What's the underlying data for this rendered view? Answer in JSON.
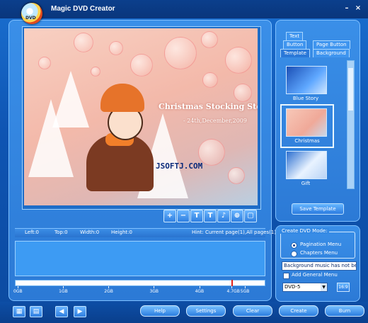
{
  "app": {
    "title": "Magic DVD Creator",
    "logo_text": "DVD",
    "minimize": "–",
    "close": "×"
  },
  "preview": {
    "title": "Christmas Stocking Story",
    "date": "- 24th,December,2009",
    "watermark": "JSOFTJ.COM"
  },
  "tools": [
    "+",
    "−",
    "T",
    "T",
    "♪",
    "⊕",
    "▢"
  ],
  "info": {
    "left": "Left:0",
    "top": "Top:0",
    "width": "Width:0",
    "height": "Height:0",
    "hint": "Hint: Current page(1),All pages(1)"
  },
  "capacity": {
    "labels": [
      "0GB",
      "1GB",
      "2GB",
      "3GB",
      "4GB",
      "4.7GB",
      "5GB"
    ],
    "max_gb": 5.3,
    "mark_gb": 4.7
  },
  "tabs": {
    "text": "Text",
    "button": "Button",
    "page_button": "Page Button",
    "template": "Template",
    "background": "Background"
  },
  "templates": [
    {
      "caption": "Blue Story"
    },
    {
      "caption": "Christmas"
    },
    {
      "caption": "Gift"
    }
  ],
  "save_template": "Save Template",
  "mode": {
    "legend": "Create DVD Mode:",
    "pagination": "Pagination Menu",
    "chapters": "Chapters Menu",
    "selected": "pagination"
  },
  "music_field": "Background music has not bee",
  "add_general_menu": "Add General Menu",
  "disc": {
    "value": "DVD-5",
    "button": "16:9"
  },
  "buttons": {
    "help": "Help",
    "settings": "Settings",
    "clear": "Clear",
    "create": "Create",
    "burn": "Burn"
  },
  "colors": {
    "accent": "#2b7ddf",
    "frame": "#0d4ea6",
    "marker": "#e0231b"
  }
}
